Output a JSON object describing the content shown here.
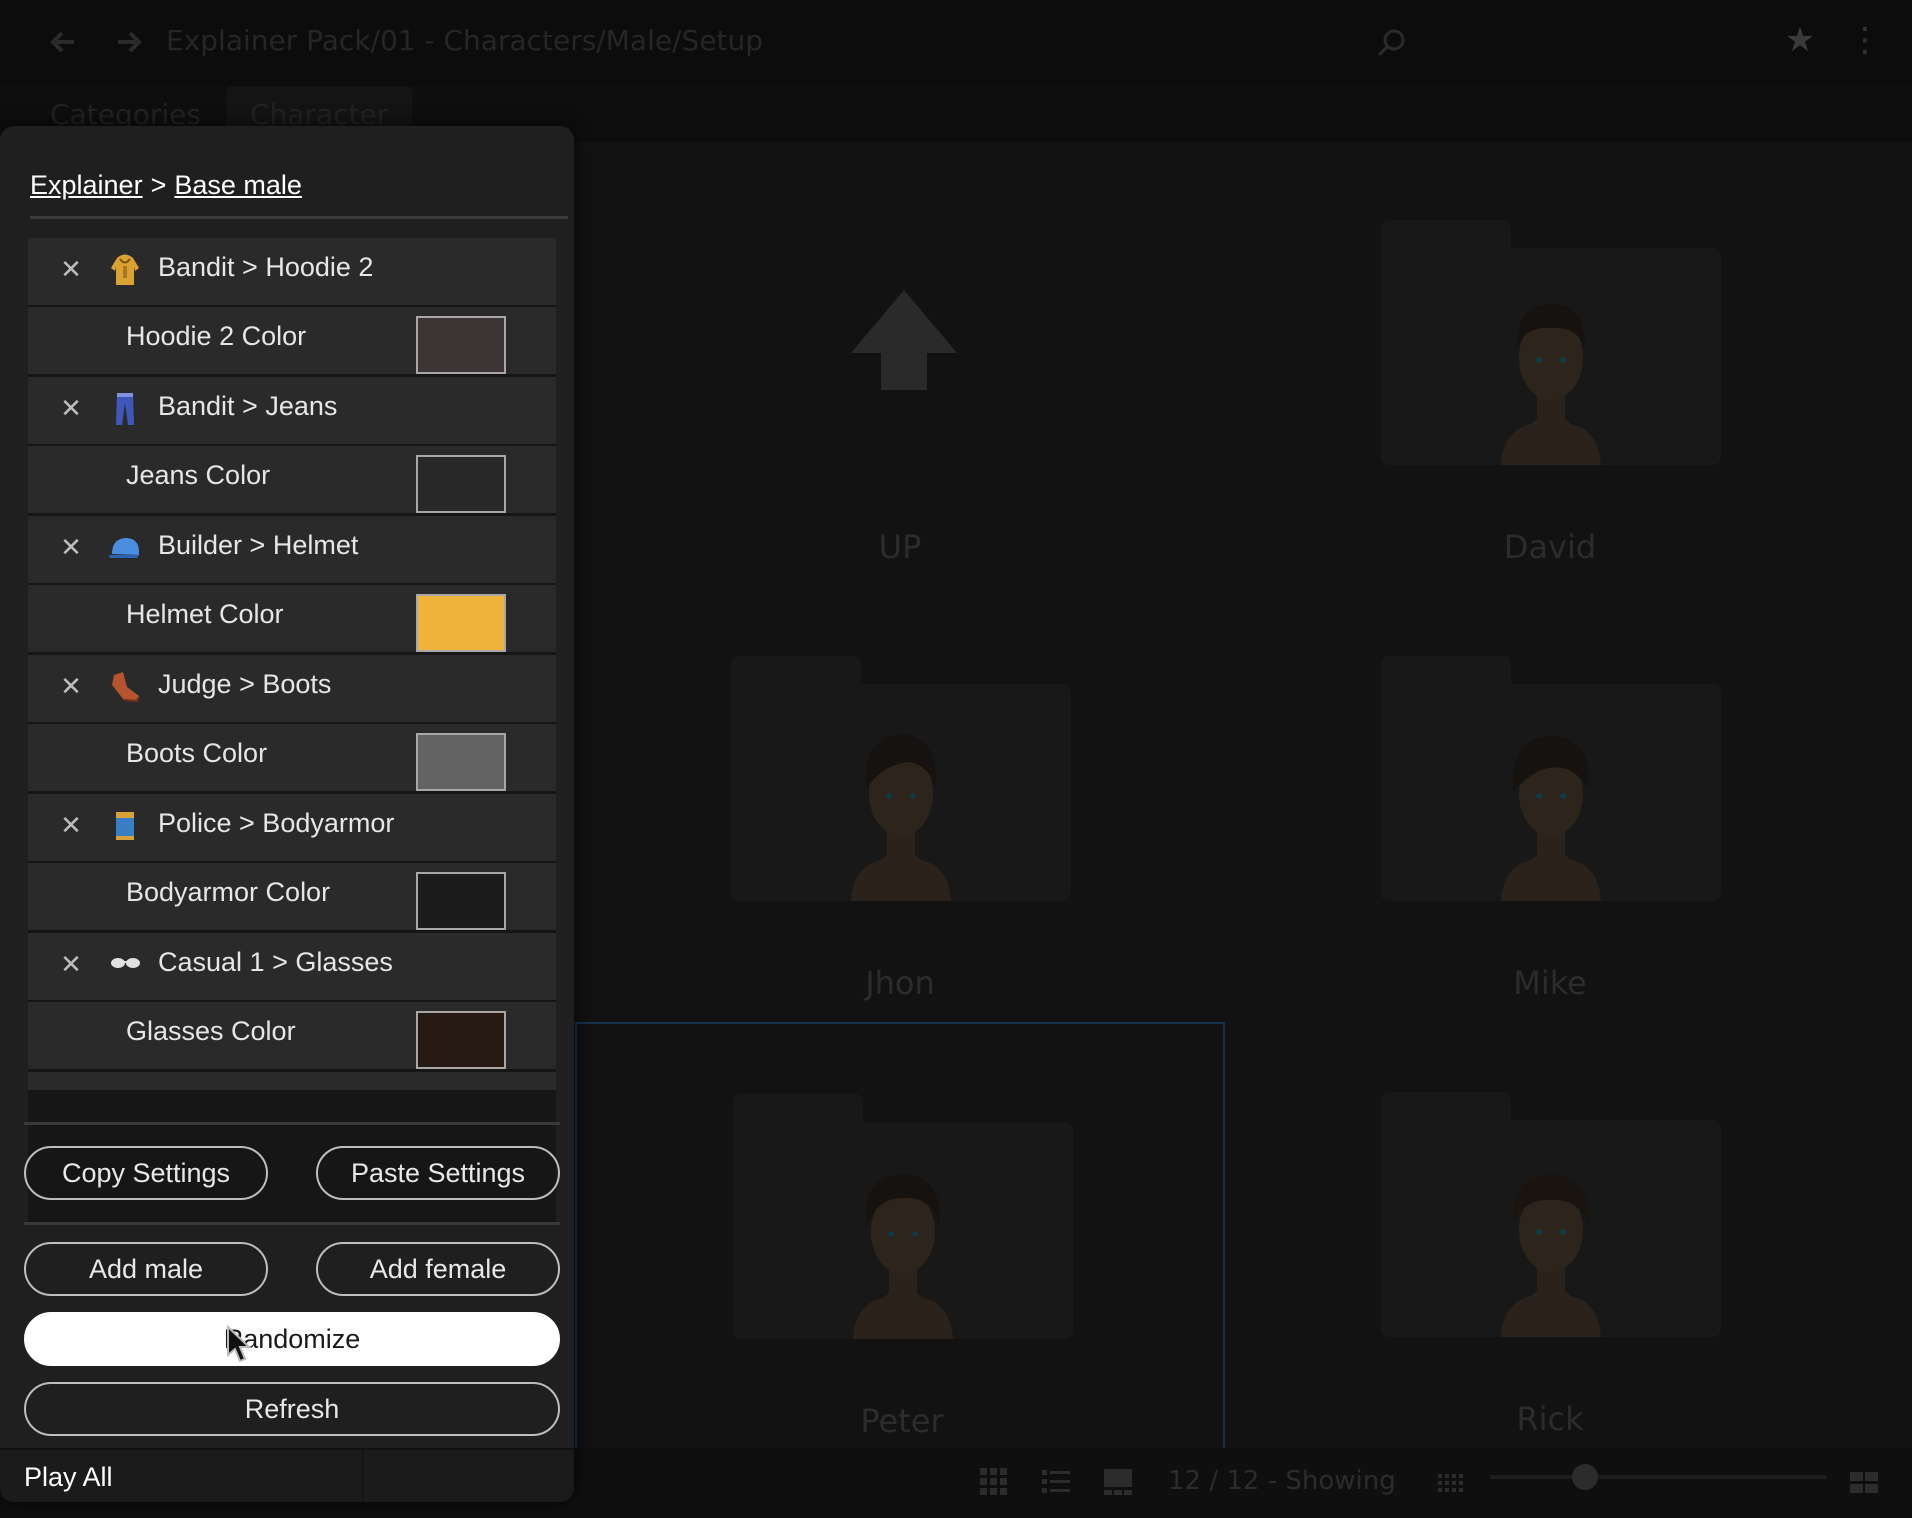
{
  "topbar": {
    "back_icon": "arrow-left-icon",
    "forward_icon": "arrow-right-icon",
    "path": "Explainer Pack/01 - Characters/Male/Setup",
    "search_icon": "search-icon",
    "star_icon": "star-icon",
    "menu_icon": "kebab-menu-icon"
  },
  "tabs": [
    {
      "label": "Categories"
    },
    {
      "label": "Character"
    }
  ],
  "grid": {
    "items": [
      {
        "name": "UP"
      },
      {
        "name": "David"
      },
      {
        "name": "Jhon"
      },
      {
        "name": "Mike"
      },
      {
        "name": "Peter"
      },
      {
        "name": "Rick"
      }
    ]
  },
  "statusbar": {
    "count_text": "12 / 12 - Showing"
  },
  "panel": {
    "breadcrumb": {
      "part1": "Explainer",
      "separator": ">",
      "part2": "Base male"
    },
    "items": [
      {
        "label": "Bandit > Hoodie 2",
        "icon": "hoodie-icon",
        "color_label": "Hoodie 2 Color",
        "color": "#3d3535"
      },
      {
        "label": "Bandit > Jeans",
        "icon": "jeans-icon",
        "color_label": "Jeans Color",
        "color": "#282828"
      },
      {
        "label": "Builder > Helmet",
        "icon": "helmet-icon",
        "color_label": "Helmet Color",
        "color": "#f0b43c"
      },
      {
        "label": "Judge > Boots",
        "icon": "boots-icon",
        "color_label": "Boots Color",
        "color": "#636363"
      },
      {
        "label": "Police > Bodyarmor",
        "icon": "bodyarmor-icon",
        "color_label": "Bodyarmor Color",
        "color": "#1c1c1c"
      },
      {
        "label": "Casual 1 > Glasses",
        "icon": "glasses-icon",
        "color_label": "Glasses Color",
        "color": "#261a12"
      }
    ],
    "remove_glyph": "✕",
    "buttons": {
      "copy": "Copy Settings",
      "paste": "Paste Settings",
      "add_male": "Add male",
      "add_female": "Add female",
      "randomize": "Randomize",
      "refresh": "Refresh"
    },
    "play_all": "Play All"
  }
}
